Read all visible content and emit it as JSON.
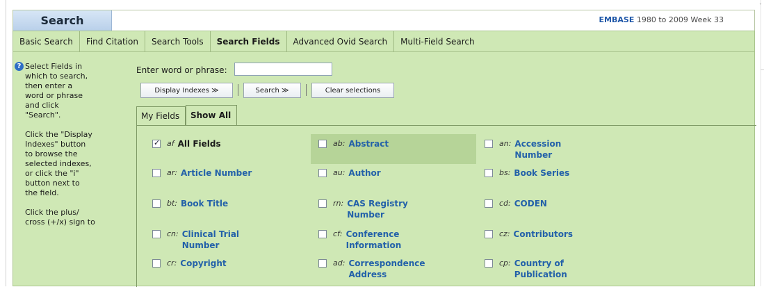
{
  "header": {
    "search_tab": "Search",
    "db_name": "EMBASE",
    "db_range": "1980 to 2009 Week 33"
  },
  "nav": {
    "tabs": [
      {
        "label": "Basic Search"
      },
      {
        "label": "Find Citation"
      },
      {
        "label": "Search Tools"
      },
      {
        "label": "Search Fields"
      },
      {
        "label": "Advanced Ovid Search"
      },
      {
        "label": "Multi-Field Search"
      }
    ],
    "active": "Search Fields"
  },
  "sidebar": {
    "help_icon": "question-circle-icon",
    "para1": "Select Fields in\nwhich to search,\nthen enter a\nword or phrase\nand click\n\"Search\".",
    "para2": "Click the \"Display\nIndexes\" button\nto browse the\nselected indexes,\nor click the \"i\"\nbutton next to\nthe field.",
    "para3": "Click the plus/\ncross (+/x) sign to"
  },
  "entry": {
    "label": "Enter word or phrase:",
    "value": ""
  },
  "buttons": {
    "display_indexes": "Display Indexes ≫",
    "search": "Search ≫",
    "clear": "Clear selections"
  },
  "field_tabs": {
    "my_fields": "My Fields",
    "show_all": "Show All"
  },
  "fields": [
    {
      "code": "af",
      "name": "All Fields",
      "checked": true
    },
    {
      "code": "ab:",
      "name": "Abstract",
      "checked": false
    },
    {
      "code": "an:",
      "name": "Accession Number",
      "checked": false
    },
    {
      "code": "ar:",
      "name": "Article Number",
      "checked": false
    },
    {
      "code": "au:",
      "name": "Author",
      "checked": false
    },
    {
      "code": "bs:",
      "name": "Book Series",
      "checked": false
    },
    {
      "code": "bt:",
      "name": "Book Title",
      "checked": false
    },
    {
      "code": "rn:",
      "name": "CAS Registry Number",
      "checked": false
    },
    {
      "code": "cd:",
      "name": "CODEN",
      "checked": false
    },
    {
      "code": "cn:",
      "name": "Clinical Trial Number",
      "checked": false
    },
    {
      "code": "cf:",
      "name": "Conference Information",
      "checked": false
    },
    {
      "code": "cz:",
      "name": "Contributors",
      "checked": false
    },
    {
      "code": "cr:",
      "name": "Copyright",
      "checked": false
    },
    {
      "code": "ad:",
      "name": "Correspondence Address",
      "checked": false
    },
    {
      "code": "cp:",
      "name": "Country of Publication",
      "checked": false
    }
  ]
}
